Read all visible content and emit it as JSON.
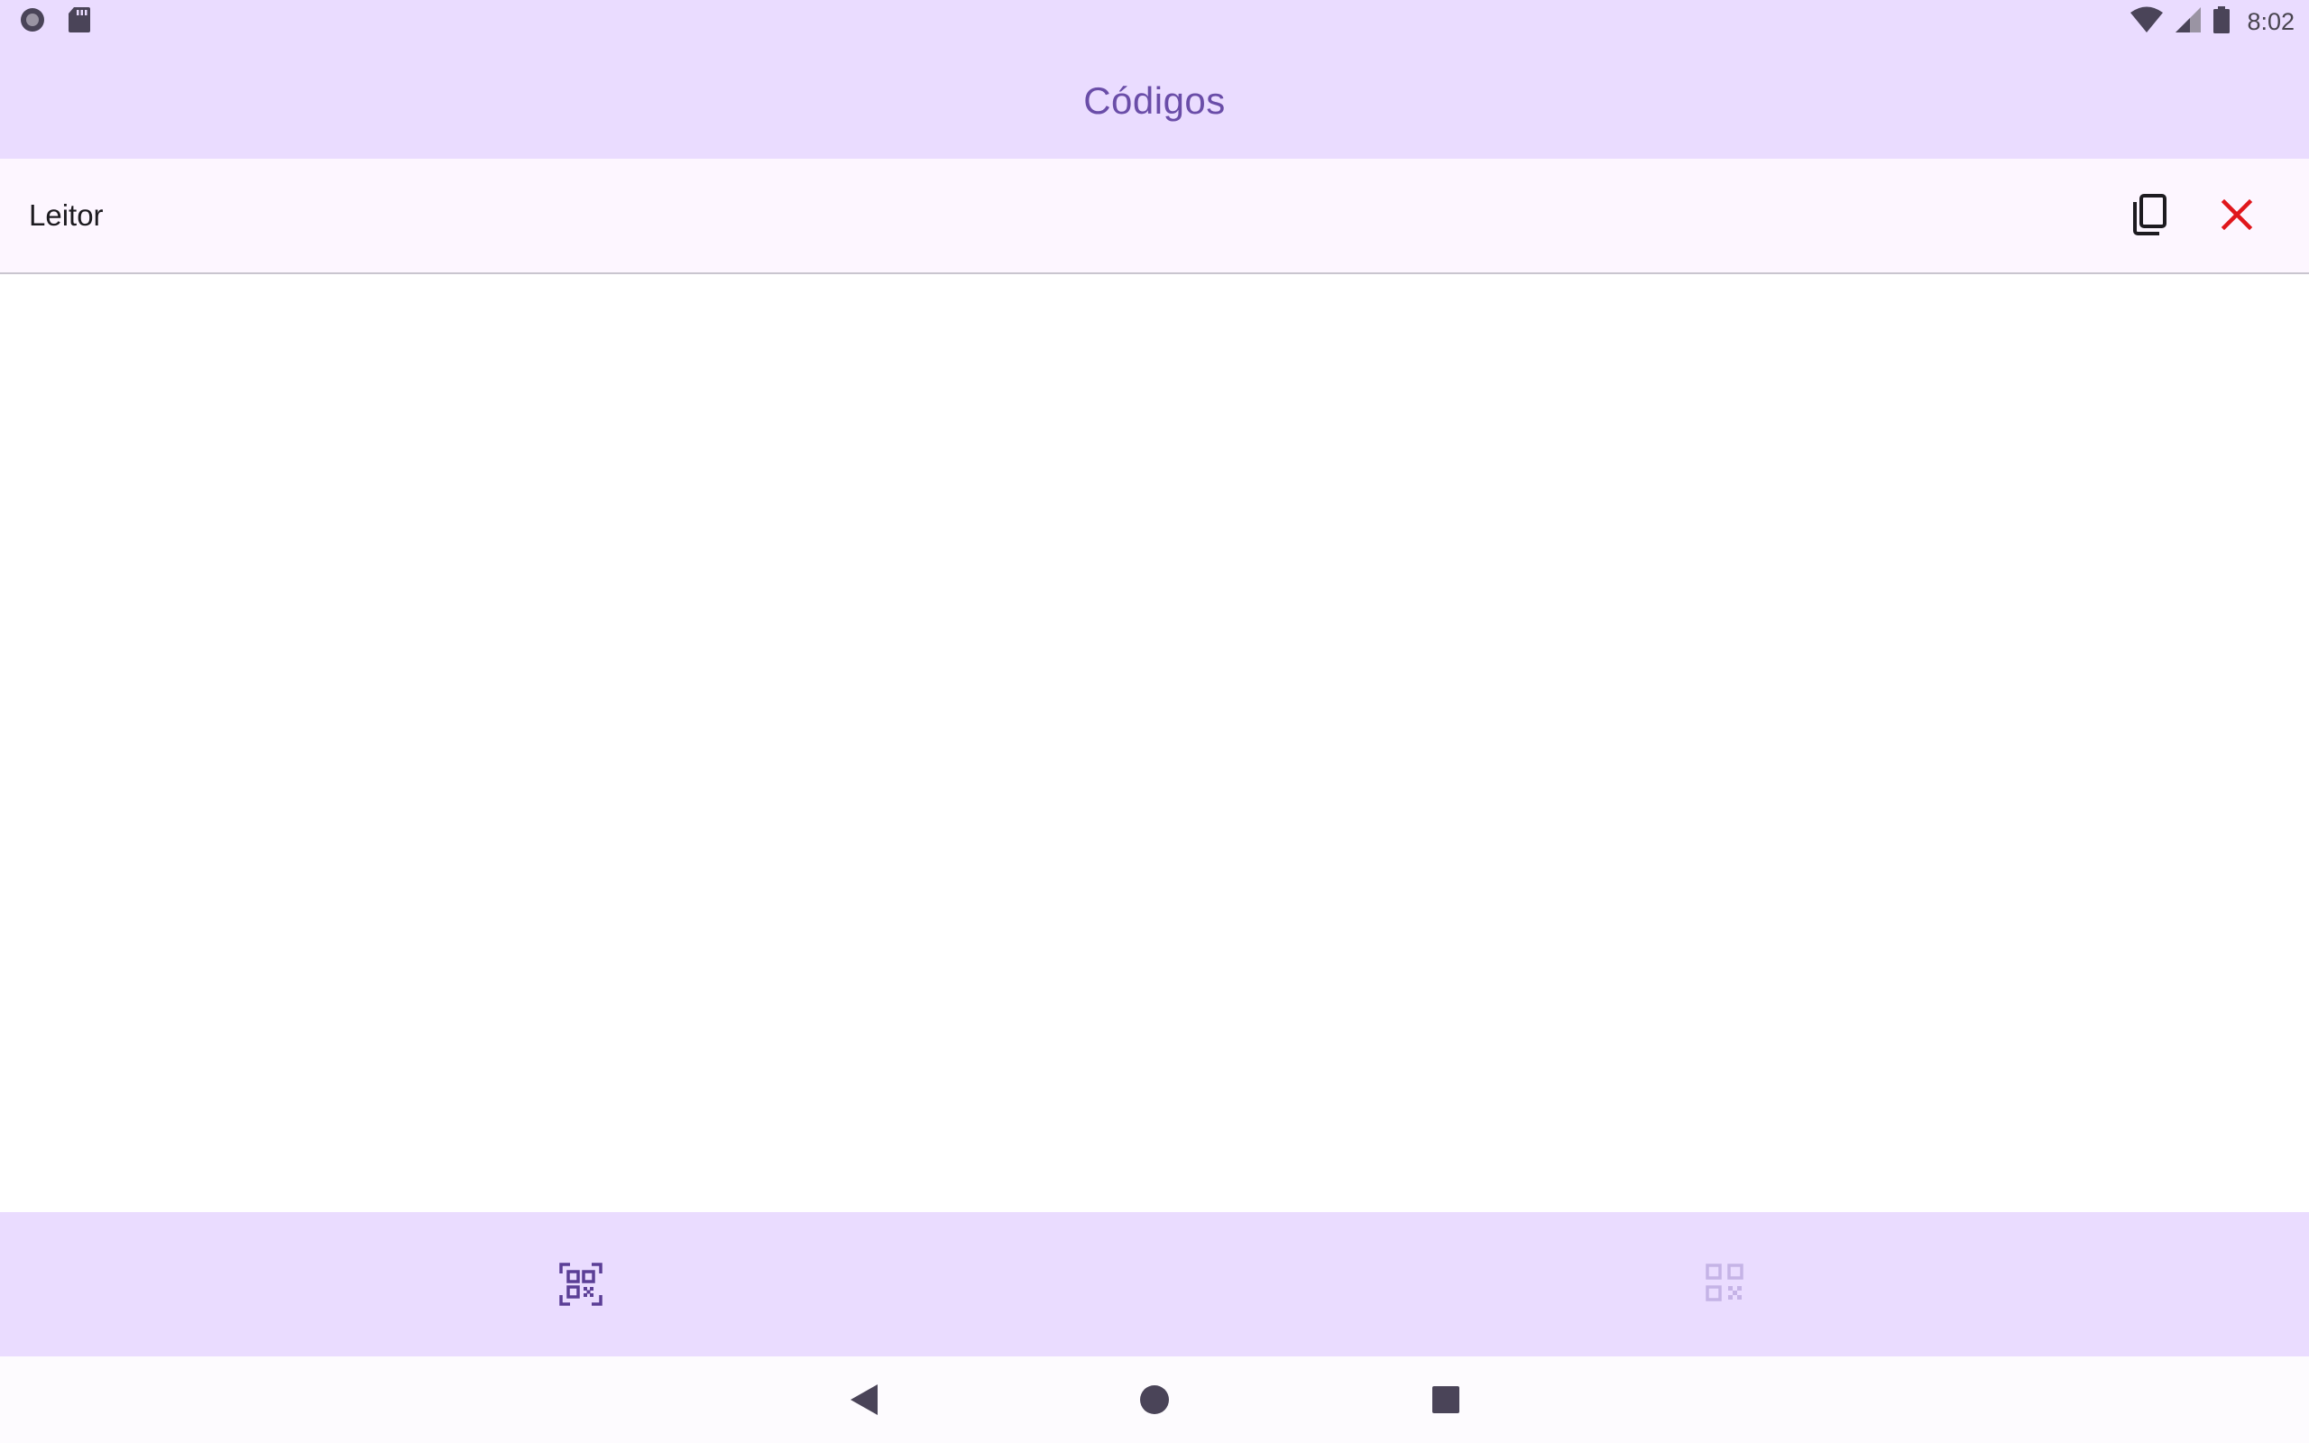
{
  "status_bar": {
    "left_icons": [
      "record-icon",
      "sd-card-icon"
    ],
    "right_icons": [
      "wifi-icon",
      "cell-signal-icon",
      "battery-icon"
    ],
    "time": "8:02"
  },
  "app_bar": {
    "title": "Códigos"
  },
  "reader": {
    "label": "Leitor",
    "copy_icon": "copy-icon",
    "clear_icon": "close-icon"
  },
  "bottom_nav": {
    "items": [
      {
        "icon": "qr-scan-icon",
        "selected": true
      },
      {
        "icon": "qr-code-icon",
        "selected": false
      }
    ]
  },
  "system_nav": {
    "buttons": [
      "back-icon",
      "home-icon",
      "recents-icon"
    ]
  },
  "colors": {
    "app_bar_bg": "#eadcff",
    "title": "#6a4da8",
    "row_bg": "#fdf6ff",
    "clear_icon": "#e0161b",
    "nav_selected": "#5b3e96",
    "nav_unselected": "#c5b3e6"
  }
}
